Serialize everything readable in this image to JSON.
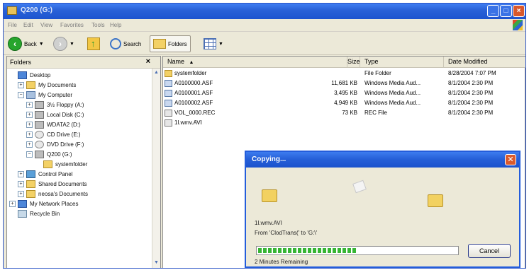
{
  "window": {
    "title": "Q200 (G:)"
  },
  "menu": [
    "File",
    "Edit",
    "View",
    "Favorites",
    "Tools",
    "Help"
  ],
  "toolbar": {
    "back_label": "Back",
    "search_label": "Search",
    "folders_label": "Folders"
  },
  "folders_pane": {
    "header": "Folders",
    "close_glyph": "×",
    "tree": [
      {
        "label": "Desktop",
        "icon": "desktop-icon",
        "indent": 0,
        "expander": ""
      },
      {
        "label": "My Documents",
        "icon": "folder-icon",
        "indent": 1,
        "expander": "+"
      },
      {
        "label": "My Computer",
        "icon": "computer-icon",
        "indent": 1,
        "expander": "−"
      },
      {
        "label": "3½ Floppy (A:)",
        "icon": "floppy-icon",
        "indent": 2,
        "expander": "+"
      },
      {
        "label": "Local Disk (C:)",
        "icon": "drive-icon",
        "indent": 2,
        "expander": "+"
      },
      {
        "label": "WDATA2 (D:)",
        "icon": "drive-icon",
        "indent": 2,
        "expander": "+"
      },
      {
        "label": "CD Drive (E:)",
        "icon": "cd-drive-icon",
        "indent": 2,
        "expander": "+"
      },
      {
        "label": "DVD Drive (F:)",
        "icon": "dvd-drive-icon",
        "indent": 2,
        "expander": "+"
      },
      {
        "label": "Q200 (G:)",
        "icon": "drive-icon",
        "indent": 2,
        "expander": "−"
      },
      {
        "label": "systemfolder",
        "icon": "folder-icon",
        "indent": 3,
        "expander": ""
      },
      {
        "label": "Control Panel",
        "icon": "control-panel-icon",
        "indent": 1,
        "expander": "+"
      },
      {
        "label": "Shared Documents",
        "icon": "folder-icon",
        "indent": 1,
        "expander": "+"
      },
      {
        "label": "neosa's Documents",
        "icon": "folder-icon",
        "indent": 1,
        "expander": "+"
      },
      {
        "label": "My Network Places",
        "icon": "network-icon",
        "indent": 0,
        "expander": "+"
      },
      {
        "label": "Recycle Bin",
        "icon": "recycle-bin-icon",
        "indent": 0,
        "expander": ""
      }
    ]
  },
  "file_list": {
    "columns": [
      "Name",
      "Size",
      "Type",
      "Date Modified"
    ],
    "rows": [
      {
        "name": "systemfolder",
        "size": "",
        "type": "File Folder",
        "date": "8/28/2004 7:07 PM",
        "icon": "folder-icon"
      },
      {
        "name": "A0100000.ASF",
        "size": "11,681 KB",
        "type": "Windows Media Aud...",
        "date": "8/1/2004 2:30 PM",
        "icon": "media-file-icon"
      },
      {
        "name": "A0100001.ASF",
        "size": "3,495 KB",
        "type": "Windows Media Aud...",
        "date": "8/1/2004 2:30 PM",
        "icon": "media-file-icon"
      },
      {
        "name": "A0100002.ASF",
        "size": "4,949 KB",
        "type": "Windows Media Aud...",
        "date": "8/1/2004 2:30 PM",
        "icon": "media-file-icon"
      },
      {
        "name": "VOL_0000.REC",
        "size": "73 KB",
        "type": "REC File",
        "date": "8/1/2004 2:30 PM",
        "icon": "rec-file-icon"
      },
      {
        "name": "1l.wmv.AVI",
        "size": "",
        "type": "",
        "date": "",
        "icon": "video-file-icon"
      }
    ]
  },
  "copy_dialog": {
    "title": "Copying...",
    "close_glyph": "✕",
    "file_name": "1l.wmv.AVI",
    "from_to": "From 'ClodTrans(' to 'G:\\'",
    "progress_fraction": 0.5,
    "cancel_label": "Cancel",
    "remaining": "2 Minutes Remaining"
  },
  "colors": {
    "title_bar": "#2a62d8",
    "progress": "#37b534",
    "close_button": "#da5a2c"
  }
}
